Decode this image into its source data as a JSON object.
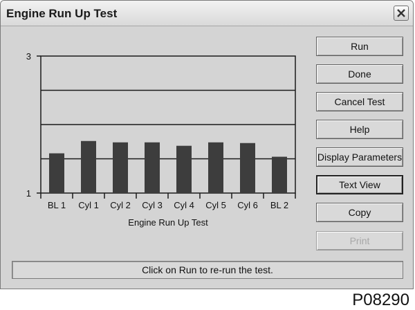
{
  "window": {
    "title": "Engine Run Up Test"
  },
  "buttons": [
    {
      "label": "Run",
      "enabled": true
    },
    {
      "label": "Done",
      "enabled": true
    },
    {
      "label": "Cancel Test",
      "enabled": true
    },
    {
      "label": "Help",
      "enabled": true
    },
    {
      "label": "Display Parameters",
      "enabled": true
    },
    {
      "label": "Text View",
      "enabled": true,
      "focused": true
    },
    {
      "label": "Copy",
      "enabled": true
    },
    {
      "label": "Print",
      "enabled": false
    }
  ],
  "status": {
    "text": "Click on Run to re-run the test."
  },
  "figure_id": "P08290",
  "chart_data": {
    "type": "bar",
    "categories": [
      "BL 1",
      "Cyl 1",
      "Cyl 2",
      "Cyl 3",
      "Cyl 4",
      "Cyl 5",
      "Cyl 6",
      "BL 2"
    ],
    "values": [
      1.58,
      1.76,
      1.74,
      1.74,
      1.69,
      1.74,
      1.73,
      1.53
    ],
    "xlabel": "Engine Run Up Test",
    "ylabel": "",
    "ylim": [
      1,
      3
    ],
    "yticks": [
      1,
      3
    ],
    "gridlines": [
      1.5,
      2,
      2.5
    ],
    "grid": true,
    "bar_color": "#3d3d3d"
  }
}
